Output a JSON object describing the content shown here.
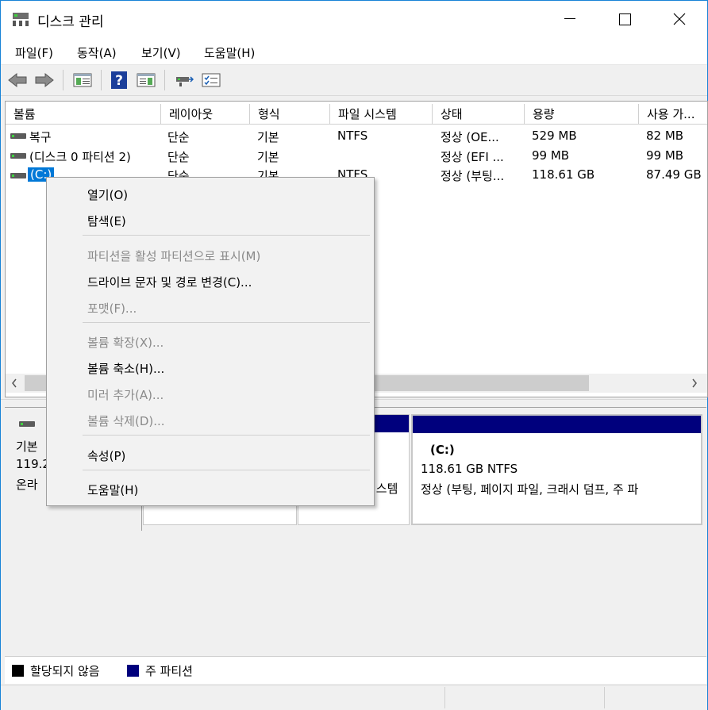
{
  "window": {
    "title": "디스크 관리"
  },
  "menu": [
    "파일(F)",
    "동작(A)",
    "보기(V)",
    "도움말(H)"
  ],
  "toolbar": {
    "icons": [
      "back-arrow-icon",
      "forward-arrow-icon",
      "show-hide-console-tree-icon",
      "help-icon",
      "properties-list-icon",
      "connect-disk-icon",
      "checklist-icon"
    ]
  },
  "table": {
    "columns": [
      "볼륨",
      "레이아웃",
      "형식",
      "파일 시스템",
      "상태",
      "용량",
      "사용 가..."
    ],
    "rows": [
      [
        "복구",
        "단순",
        "기본",
        "NTFS",
        "정상 (OE...",
        "529 MB",
        "82 MB"
      ],
      [
        "(디스크 0 파티션 2)",
        "단순",
        "기본",
        "",
        "정상 (EFI ...",
        "99 MB",
        "99 MB"
      ],
      [
        "(C:)",
        "단순",
        "기본",
        "NTFS",
        "정상 (부팅...",
        "118.61 GB",
        "87.49 GB"
      ]
    ]
  },
  "disk": {
    "line1": "기본",
    "line2": "119.2",
    "line3": "온라"
  },
  "partitions": {
    "p2_text": "시스템",
    "c": {
      "name": "(C:)",
      "size": "118.61 GB NTFS",
      "status": "정상 (부팅, 페이지 파일, 크래시 덤프, 주 파"
    }
  },
  "legend": {
    "unallocated": "할당되지 않음",
    "primary": "주 파티션"
  },
  "colors": {
    "unallocated": "#000000",
    "primary": "#00007d",
    "selection": "#0078d7"
  },
  "context_menu": [
    {
      "label": "열기(O)",
      "enabled": true
    },
    {
      "label": "탐색(E)",
      "enabled": true
    },
    {
      "label": "파티션을 활성 파티션으로 표시(M)",
      "enabled": false
    },
    {
      "label": "드라이브 문자 및 경로 변경(C)...",
      "enabled": true
    },
    {
      "label": "포맷(F)...",
      "enabled": false
    },
    {
      "label": "볼륨 확장(X)...",
      "enabled": false
    },
    {
      "label": "볼륨 축소(H)...",
      "enabled": true
    },
    {
      "label": "미러 추가(A)...",
      "enabled": false
    },
    {
      "label": "볼륨 삭제(D)...",
      "enabled": false
    },
    {
      "label": "속성(P)",
      "enabled": true
    },
    {
      "label": "도움말(H)",
      "enabled": true
    }
  ]
}
